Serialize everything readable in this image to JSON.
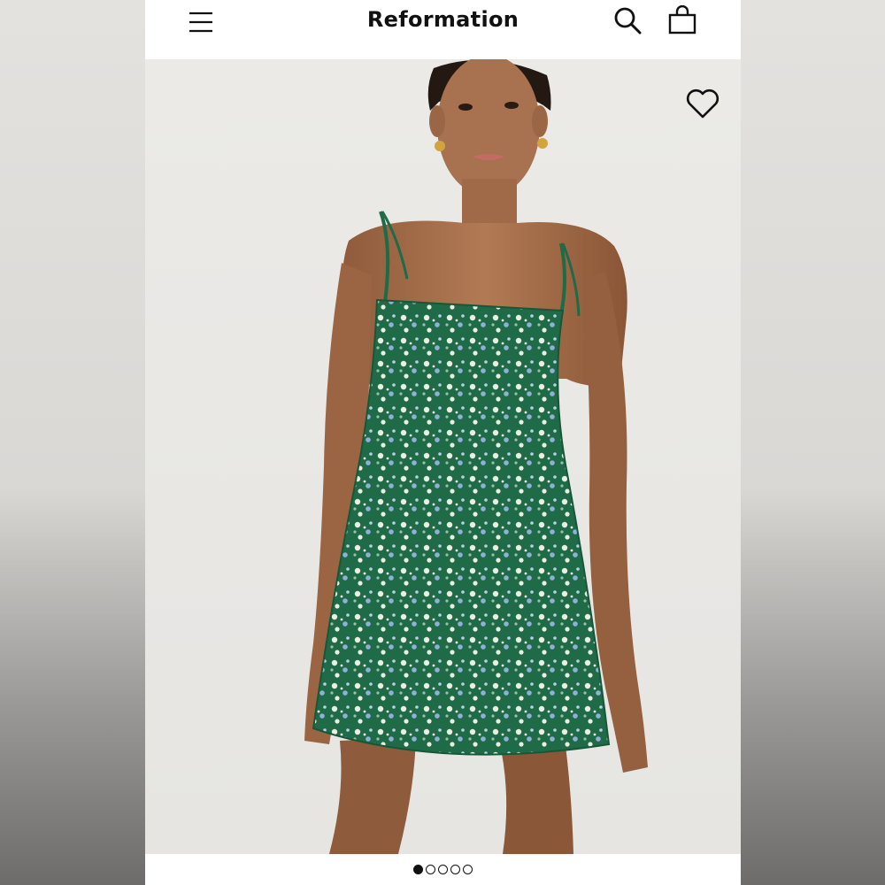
{
  "header": {
    "brand": "Reformation",
    "icons": {
      "menu": "hamburger-menu-icon",
      "search": "search-icon",
      "bag": "shopping-bag-icon"
    }
  },
  "gallery": {
    "image_description_icon": "product-photo",
    "wishlist_icon": "heart-outline-icon",
    "dot_count": 5,
    "active_index": 0
  },
  "colors": {
    "background": "#ffffff",
    "text": "#111111",
    "dress_green": "#1f6b47",
    "photo_bg": "#e8e7e4"
  }
}
